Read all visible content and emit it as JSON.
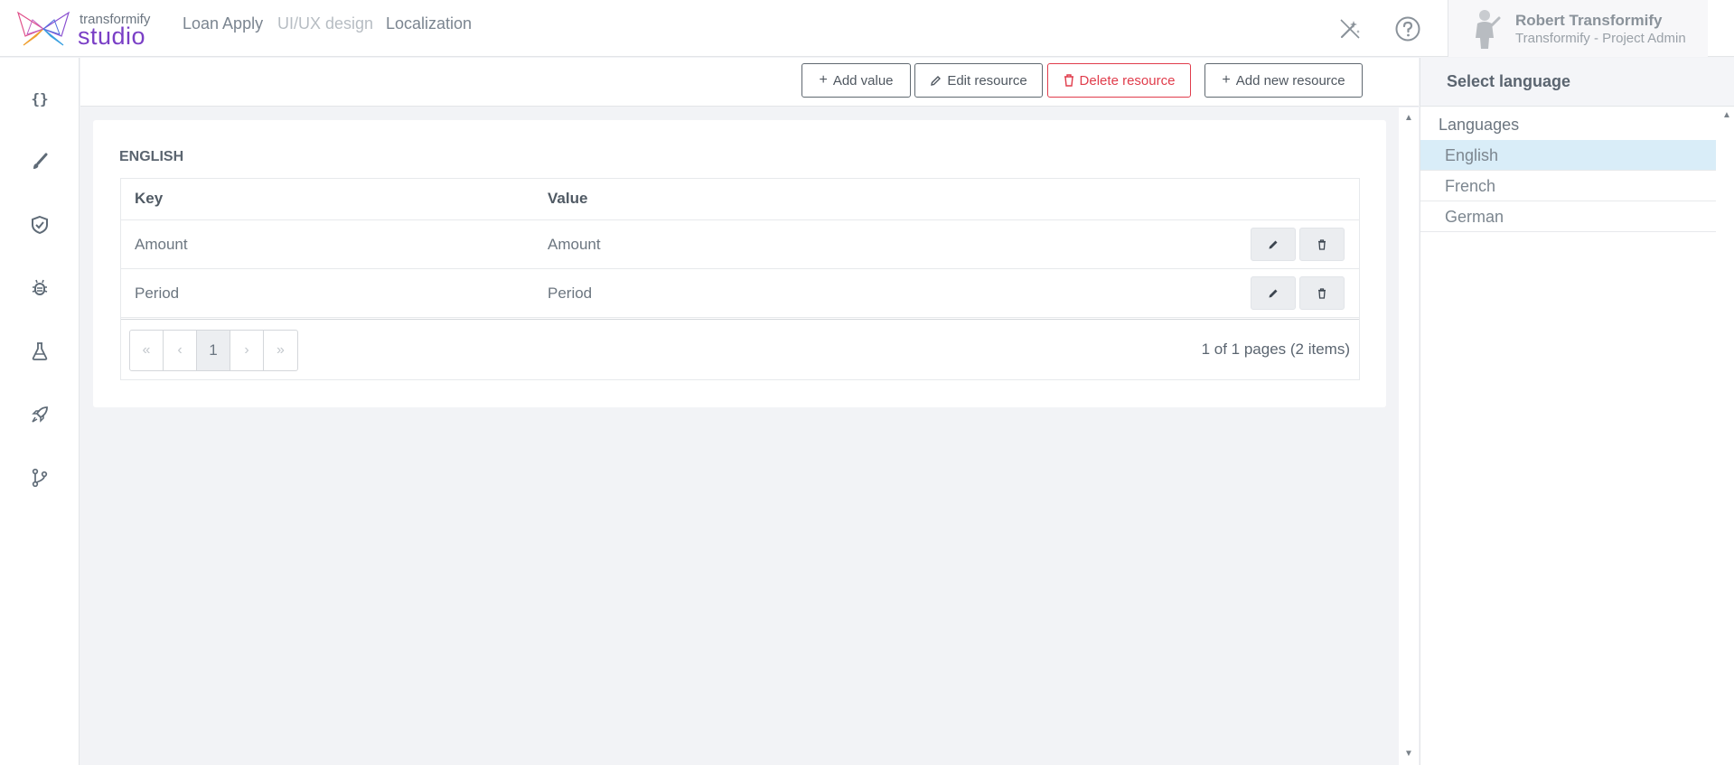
{
  "app": {
    "logo_small": "transformify",
    "logo_big": "studio"
  },
  "nav": {
    "items": [
      {
        "label": "Loan Apply",
        "disabled": false
      },
      {
        "label": "UI/UX design",
        "disabled": true
      },
      {
        "label": "Localization",
        "disabled": false
      }
    ]
  },
  "header_icons": [
    "magic-wand-off-icon",
    "help-icon"
  ],
  "user": {
    "name": "Robert Transformify",
    "role": "Transformify - Project Admin"
  },
  "rail": {
    "icons": [
      "code-braces-icon",
      "brush-icon",
      "shield-check-icon",
      "bug-icon",
      "flask-icon",
      "rocket-icon",
      "branch-icon"
    ]
  },
  "toolbar": {
    "add_value": "Add value",
    "edit_resource": "Edit resource",
    "delete_resource": "Delete resource",
    "add_new_resource": "Add new resource"
  },
  "resource": {
    "title": "ENGLISH",
    "columns": {
      "key": "Key",
      "value": "Value"
    },
    "rows": [
      {
        "key": "Amount",
        "value": "Amount"
      },
      {
        "key": "Period",
        "value": "Period"
      }
    ],
    "pager": {
      "current_page": "1",
      "info": "1 of 1 pages (2 items)"
    }
  },
  "language_panel": {
    "title": "Select language",
    "group": "Languages",
    "languages": [
      "English",
      "French",
      "German"
    ],
    "selected": "English"
  },
  "colors": {
    "brand": "#7a3fc6",
    "danger": "#e03c4b",
    "selected_row": "#d9edf8",
    "background": "#f2f3f6"
  }
}
